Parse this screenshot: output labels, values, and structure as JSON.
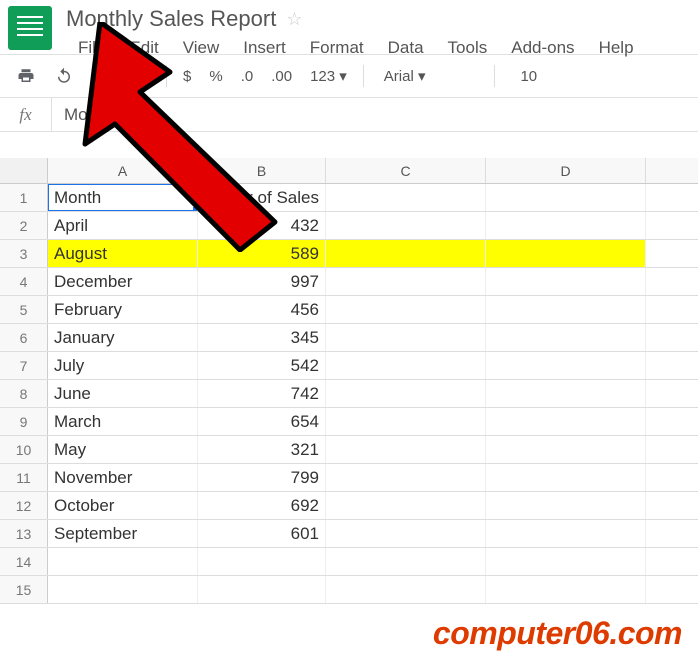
{
  "header": {
    "doc_title": "Monthly Sales Report",
    "menu": [
      "File",
      "Edit",
      "View",
      "Insert",
      "Format",
      "Data",
      "Tools",
      "Add-ons",
      "Help"
    ]
  },
  "toolbar": {
    "currency": "$",
    "percent": "%",
    "dec_dec": ".0",
    "dec_inc": ".00",
    "number_format": "123",
    "font_name": "Arial",
    "font_size": "10"
  },
  "formula_bar": {
    "label": "fx",
    "value": "Month"
  },
  "columns": [
    "A",
    "B",
    "C",
    "D"
  ],
  "selected_cell": "A1",
  "highlighted_row_index": 2,
  "rows": [
    {
      "n": "1",
      "a": "Month",
      "b": "Number of Sales"
    },
    {
      "n": "2",
      "a": "April",
      "b": "432"
    },
    {
      "n": "3",
      "a": "August",
      "b": "589"
    },
    {
      "n": "4",
      "a": "December",
      "b": "997"
    },
    {
      "n": "5",
      "a": "February",
      "b": "456"
    },
    {
      "n": "6",
      "a": "January",
      "b": "345"
    },
    {
      "n": "7",
      "a": "July",
      "b": "542"
    },
    {
      "n": "8",
      "a": "June",
      "b": "742"
    },
    {
      "n": "9",
      "a": "March",
      "b": "654"
    },
    {
      "n": "10",
      "a": "May",
      "b": "321"
    },
    {
      "n": "11",
      "a": "November",
      "b": "799"
    },
    {
      "n": "12",
      "a": "October",
      "b": "692"
    },
    {
      "n": "13",
      "a": "September",
      "b": "601"
    },
    {
      "n": "14",
      "a": "",
      "b": ""
    },
    {
      "n": "15",
      "a": "",
      "b": ""
    }
  ],
  "watermark": "computer06.com"
}
